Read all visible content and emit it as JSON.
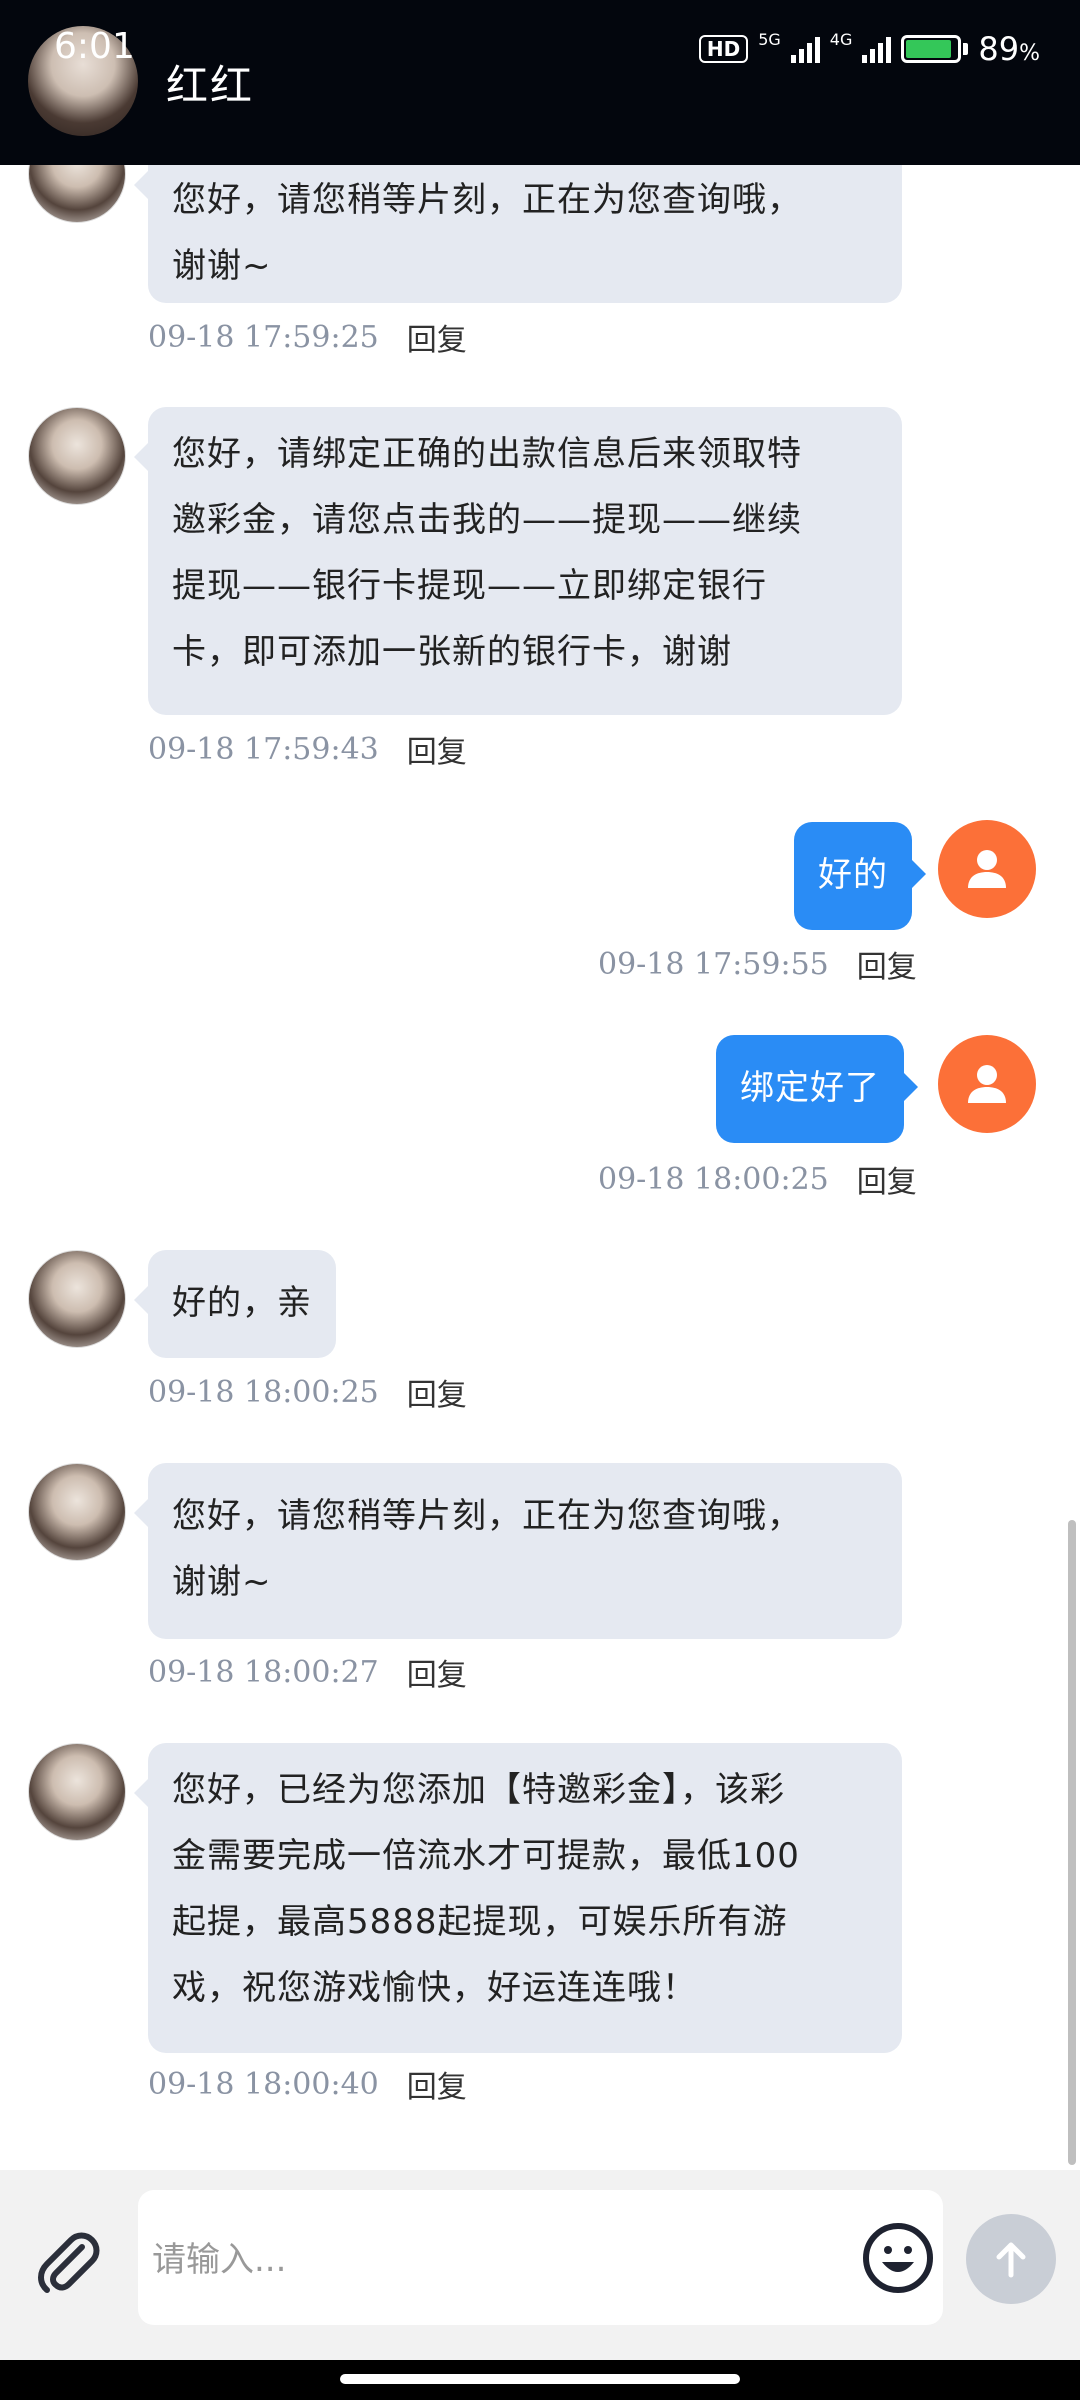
{
  "status_bar": {
    "time": "6:01",
    "hd_label": "HD",
    "network_1": "5G",
    "network_2": "4G",
    "battery_percent": "89",
    "battery_unit": "%"
  },
  "header": {
    "title": "红红"
  },
  "messages": [
    {
      "side": "left",
      "text_lines": [
        "您好，请您稍等片刻，正在为您查询哦，",
        "谢谢~"
      ],
      "time": "09-18 17:59:25",
      "reply": "回复"
    },
    {
      "side": "left",
      "text_lines": [
        "您好，请绑定正确的出款信息后来领取特",
        "邀彩金，请您点击我的——提现——继续",
        "提现——银行卡提现——立即绑定银行",
        "卡，即可添加一张新的银行卡，谢谢"
      ],
      "time": "09-18 17:59:43",
      "reply": "回复"
    },
    {
      "side": "right",
      "text_lines": [
        "好的"
      ],
      "time": "09-18 17:59:55",
      "reply": "回复"
    },
    {
      "side": "right",
      "text_lines": [
        "绑定好了"
      ],
      "time": "09-18 18:00:25",
      "reply": "回复"
    },
    {
      "side": "left",
      "text_lines": [
        "好的，亲"
      ],
      "time": "09-18 18:00:25",
      "reply": "回复"
    },
    {
      "side": "left",
      "text_lines": [
        "您好，请您稍等片刻，正在为您查询哦，",
        "谢谢~"
      ],
      "time": "09-18 18:00:27",
      "reply": "回复"
    },
    {
      "side": "left",
      "text_lines": [
        "您好，已经为您添加【特邀彩金】，该彩",
        "金需要完成一倍流水才可提款，最低100",
        "起提，最高5888起提现，可娱乐所有游",
        "戏，祝您游戏愉快，好运连连哦！"
      ],
      "time": "09-18 18:00:40",
      "reply": "回复"
    }
  ],
  "input": {
    "placeholder": "请输入..."
  },
  "colors": {
    "header_bg": "#03060d",
    "bubble_left": "#e5e9f1",
    "bubble_right": "#2a8cf5",
    "user_avatar": "#fc7038",
    "send_button": "#c9ced6"
  },
  "icons": {
    "attach": "paperclip-icon",
    "emoji": "smiley-icon",
    "send": "arrow-up-icon",
    "user_avatar": "person-icon"
  }
}
